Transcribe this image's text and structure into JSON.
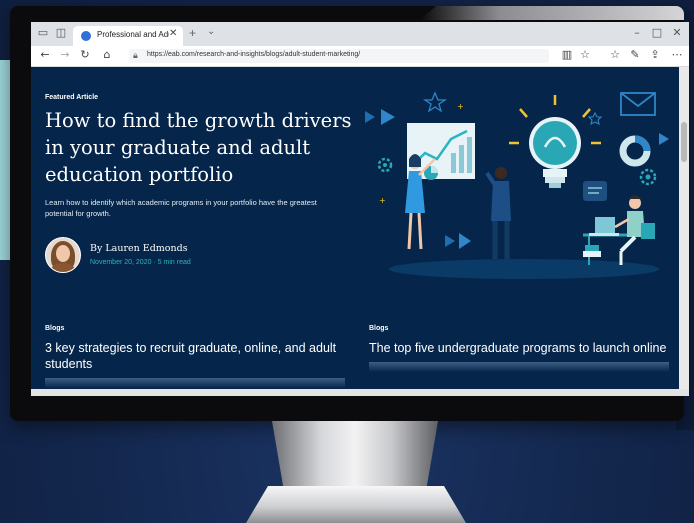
{
  "browser": {
    "tab_title": "Professional and Adult E",
    "tab_close": "✕",
    "new_tab": "+",
    "tab_list": "⌄",
    "url": "https://eab.com/research-and-insights/blogs/adult-student-marketing/",
    "icons": [
      "tab-actions-icon",
      "back-icon",
      "forward-icon",
      "refresh-icon",
      "home-icon",
      "lock-icon",
      "reading-view-icon",
      "favorite-star-icon",
      "favorites-icon",
      "pen-icon",
      "share-icon",
      "more-icon"
    ]
  },
  "article": {
    "eyebrow": "Featured Article",
    "title": "How to find the growth drivers in your graduate and adult education portfolio",
    "lead": "Learn how to identify which academic programs in your portfolio have the greatest potential for growth.",
    "author": "By Lauren Edmonds",
    "meta": "November 20, 2020 · 5 min read"
  },
  "cards": [
    {
      "tag": "Blogs",
      "title": "3 key strategies to recruit graduate, online, and adult students"
    },
    {
      "tag": "Blogs",
      "title": "The top five undergraduate programs to launch online"
    }
  ],
  "colors": {
    "page_bg": "#05264a",
    "accent_teal": "#29b5c0",
    "accent_yellow": "#f2c230",
    "accent_blue": "#2f6fd6"
  }
}
